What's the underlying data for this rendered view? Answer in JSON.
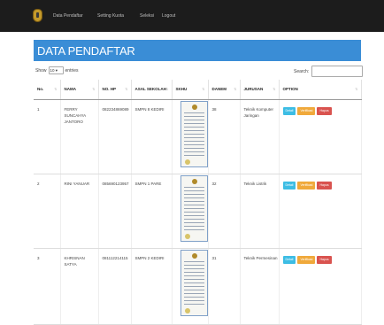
{
  "navbar": {
    "links": [
      "Data Pendaftar",
      "Setting Kuota",
      "Seleksi",
      "Logout"
    ]
  },
  "panel": {
    "title": "DATA PENDAFTAR"
  },
  "length_control": {
    "prefix": "Show",
    "value": "10",
    "suffix": "entries"
  },
  "search": {
    "label": "Search:",
    "value": ""
  },
  "table": {
    "headers": [
      "No.",
      "NAMA",
      "NO. HP",
      "ASAL SEKOLAH",
      "SKHU",
      "DANEM",
      "JURUSAN",
      "OPTION"
    ],
    "rows": [
      {
        "no": "1",
        "nama": "FERRY SUNCAHYA JANTORO",
        "hp": "082234869089",
        "sekolah": "SMPN 8 KEDIRI",
        "danem": "38",
        "jurusan": "Teknik Komputer Jaringan"
      },
      {
        "no": "2",
        "nama": "RINI YANUAR",
        "hp": "085690123957",
        "sekolah": "SMPN 1 PARE",
        "danem": "32",
        "jurusan": "Teknik Listrik"
      },
      {
        "no": "3",
        "nama": "KHRISNAN SATYA",
        "hp": "081112214115",
        "sekolah": "SMPN 2 KEDIRI",
        "danem": "31",
        "jurusan": "Teknik Permesinan"
      }
    ],
    "actions": {
      "detail": "Detail",
      "verify": "Verifikasi",
      "delete": "Hapus"
    }
  },
  "colors": {
    "navbar_bg": "#1c1c1c",
    "panel_heading": "#3a8dd6",
    "btn_detail": "#3dbde4",
    "btn_verify": "#f0a93b",
    "btn_delete": "#d9534f"
  },
  "icons": {
    "logo": "school-emblem-icon",
    "skhu": "document-thumbnail-icon",
    "sort": "sort-arrows-icon"
  }
}
